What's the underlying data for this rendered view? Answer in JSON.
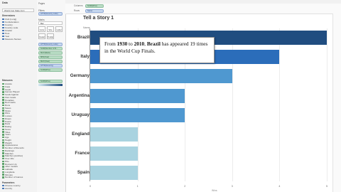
{
  "data_pane": {
    "title": "Data",
    "source": "World Cup Stats (inc)",
    "dimensions_header": "Dimensions",
    "dimensions": [
      "Club (Long)",
      "Confederation",
      "Country",
      "Country code",
      "Finalist",
      "Host",
      "Year",
      "Measure Names"
    ],
    "measures_header": "Measures",
    "measures": [
      "Assists",
      "Caps",
      "Goals",
      "Games Played",
      "Goals Against",
      "Own Goals",
      "Penalties",
      "Red Cards",
      "Runs",
      "Saves",
      "Shots",
      "Wins",
      "Losses",
      "Draws",
      "Points",
      "Rank",
      "Rating",
      "Score",
      "Titles",
      "Years",
      "Age",
      "Height",
      "Weight",
      "Appearances",
      "Number of Records",
      "Rankings",
      "Matches",
      "Matches (positive)",
      "Over 40s",
      "PKs",
      "Runners Up",
      "other models",
      "Latitude",
      "Longitude",
      "Minutes",
      "Number of Games"
    ],
    "params_header": "Parameters",
    "params": [
      "Choose country",
      "country"
    ]
  },
  "marks_pane": {
    "pages_label": "Pages",
    "filters_label": "Filters",
    "filter_pill": "ATTR(Country code)",
    "marks_label": "Marks",
    "mark_type": "Bar",
    "mark_buttons": [
      "Color",
      "Size",
      "Label",
      "Detail",
      "Tooltip"
    ],
    "mark_pills": [
      "ATTR(Country code)",
      "SUM(Number of R...",
      "MAX(Rank)",
      "MIN(Year)",
      "MAX(Year)",
      "ATTR(Country)",
      "SUM(Wins)"
    ],
    "legend_pill": "SUM(Wins)"
  },
  "toolbar": {
    "columns_label": "Columns",
    "columns_pill": "SUM(Wins)",
    "rows_label": "Rows",
    "rows_pill": "Name"
  },
  "story": {
    "title": "Tell a Story 1",
    "axis_header": "Name",
    "x_axis_title": "Wins"
  },
  "annotation": {
    "pre": "From ",
    "y1": "1930",
    "mid1": " to ",
    "y2": "2010",
    "mid2": ", ",
    "country": "Brazil",
    "post": " has appeared 19 times in the World Cup Finals."
  },
  "colors": {
    "dark_bar": "#204d80",
    "mid_bar": "#2b6dba",
    "light_bar": "#4f98d0",
    "pale_bar": "#a9d3e0"
  },
  "chart_data": {
    "type": "bar",
    "orientation": "horizontal",
    "categories": [
      "Brazil",
      "Italy",
      "Germany",
      "Argentina",
      "Uruguay",
      "England",
      "France",
      "Spain"
    ],
    "values": [
      5,
      4,
      3,
      2,
      2,
      1,
      1,
      1
    ],
    "xlabel": "Wins",
    "ylabel": "Name",
    "xlim": [
      0,
      5
    ],
    "ticks": [
      "0",
      "1",
      "2",
      "3",
      "4",
      "5"
    ],
    "grid": true
  }
}
